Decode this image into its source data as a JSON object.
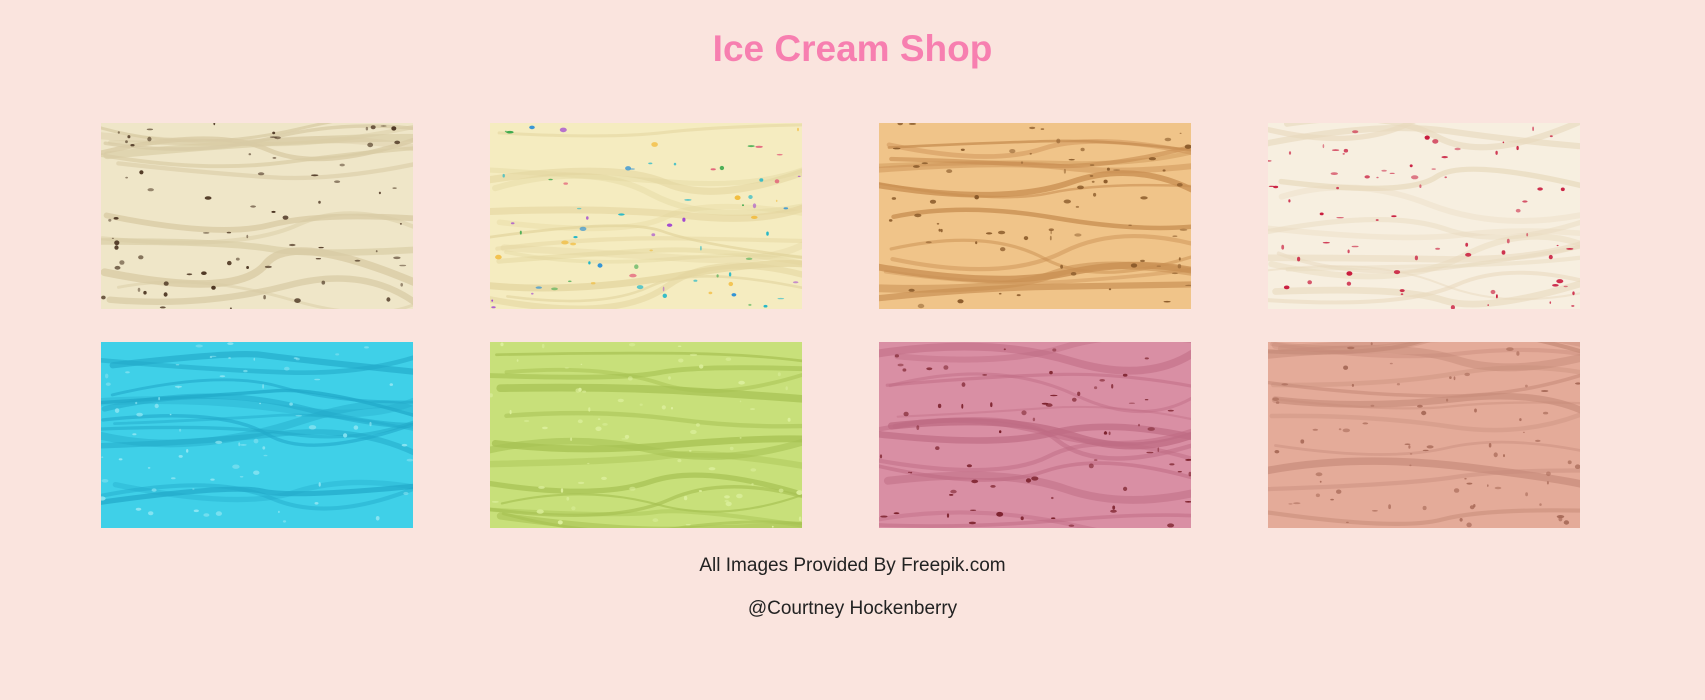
{
  "header": {
    "title": "Ice Cream Shop"
  },
  "gallery": {
    "images": [
      {
        "flavor": "cookies-and-cream",
        "base": "#efe6c8",
        "shade": "#d8cba4",
        "speck": "#4a3320"
      },
      {
        "flavor": "vanilla-sprinkles",
        "base": "#f5ecc0",
        "shade": "#e3d59e",
        "speck": "#e04a6e"
      },
      {
        "flavor": "caramel",
        "base": "#f0c489",
        "shade": "#c98f52",
        "speck": "#8a5a2a"
      },
      {
        "flavor": "cherry-vanilla",
        "base": "#f7efe0",
        "shade": "#e8d9bd",
        "speck": "#c8173a"
      },
      {
        "flavor": "blue-raspberry",
        "base": "#3fd0e8",
        "shade": "#22a9c9",
        "speck": "#8fe6f3"
      },
      {
        "flavor": "lime",
        "base": "#c8e07a",
        "shade": "#a7c153",
        "speck": "#dcef9c"
      },
      {
        "flavor": "strawberry",
        "base": "#d98fa4",
        "shade": "#bf6c84",
        "speck": "#7a1f2a"
      },
      {
        "flavor": "chocolate-pink",
        "base": "#e4ab99",
        "shade": "#c78c7a",
        "speck": "#a86a58"
      }
    ]
  },
  "footer": {
    "credit": "All Images Provided By Freepik.com",
    "author": "@Courtney Hockenberry"
  }
}
